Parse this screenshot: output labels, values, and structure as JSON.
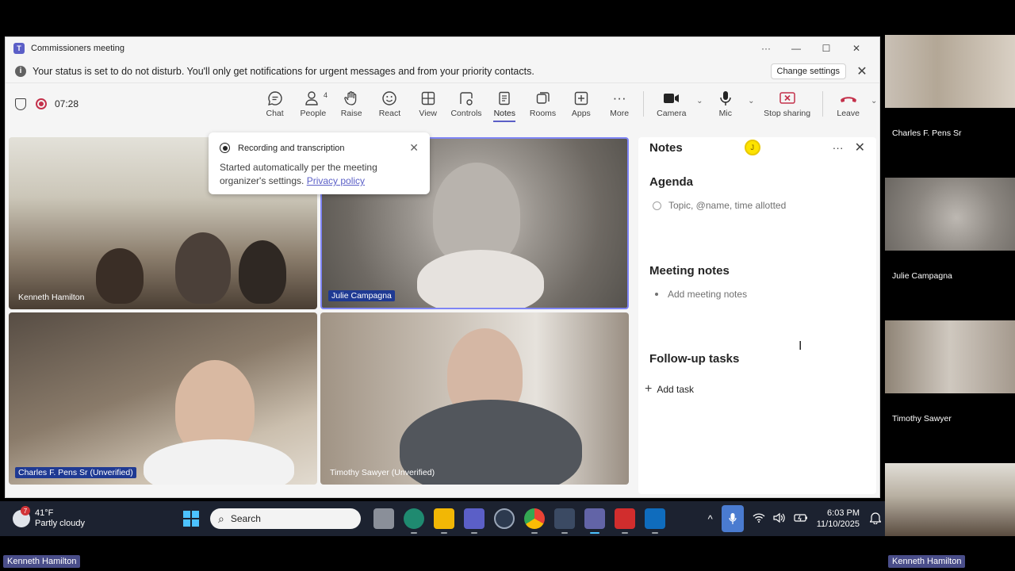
{
  "window": {
    "title": "Commissioners meeting",
    "controls": {
      "more": "···",
      "minimize": "—",
      "maximize": "☐",
      "close": "✕"
    }
  },
  "banner": {
    "message": "Your status is set to do not disturb. You'll only get notifications for urgent messages and from your priority contacts.",
    "change_settings": "Change settings",
    "close": "✕"
  },
  "toolbar": {
    "timer": "07:28",
    "chat": "Chat",
    "people": "People",
    "people_count": "4",
    "raise": "Raise",
    "react": "React",
    "view": "View",
    "controls": "Controls",
    "notes": "Notes",
    "rooms": "Rooms",
    "apps": "Apps",
    "more": "More",
    "camera": "Camera",
    "mic": "Mic",
    "stop_sharing": "Stop sharing",
    "leave": "Leave",
    "accent": "#5b5fc7",
    "leave_color": "#c4314b"
  },
  "popup": {
    "title": "Recording and transcription",
    "body": "Started automatically per the meeting organizer's settings.",
    "link": "Privacy policy"
  },
  "participants": {
    "tile1": "Kenneth Hamilton",
    "tile2": "Julie Campagna",
    "tile3": "Charles F. Pens Sr (Unverified)",
    "tile4": "Timothy Sawyer (Unverified)"
  },
  "notes": {
    "title": "Notes",
    "avatar": "J",
    "agenda_title": "Agenda",
    "agenda_placeholder": "Topic, @name, time allotted",
    "meeting_notes_title": "Meeting notes",
    "meeting_notes_placeholder": "Add meeting notes",
    "followup_title": "Follow-up tasks",
    "add_task": "Add task"
  },
  "side_gallery": {
    "p1": "Charles F. Pens Sr",
    "p2": "Julie Campagna",
    "p3": "Timothy Sawyer"
  },
  "taskbar": {
    "weather_temp": "41°F",
    "weather_desc": "Partly cloudy",
    "weather_badge": "7",
    "search": "Search",
    "time": "6:03 PM",
    "date": "11/10/2025"
  },
  "bottom_names": {
    "left": "Kenneth Hamilton",
    "right": "Kenneth Hamilton"
  }
}
